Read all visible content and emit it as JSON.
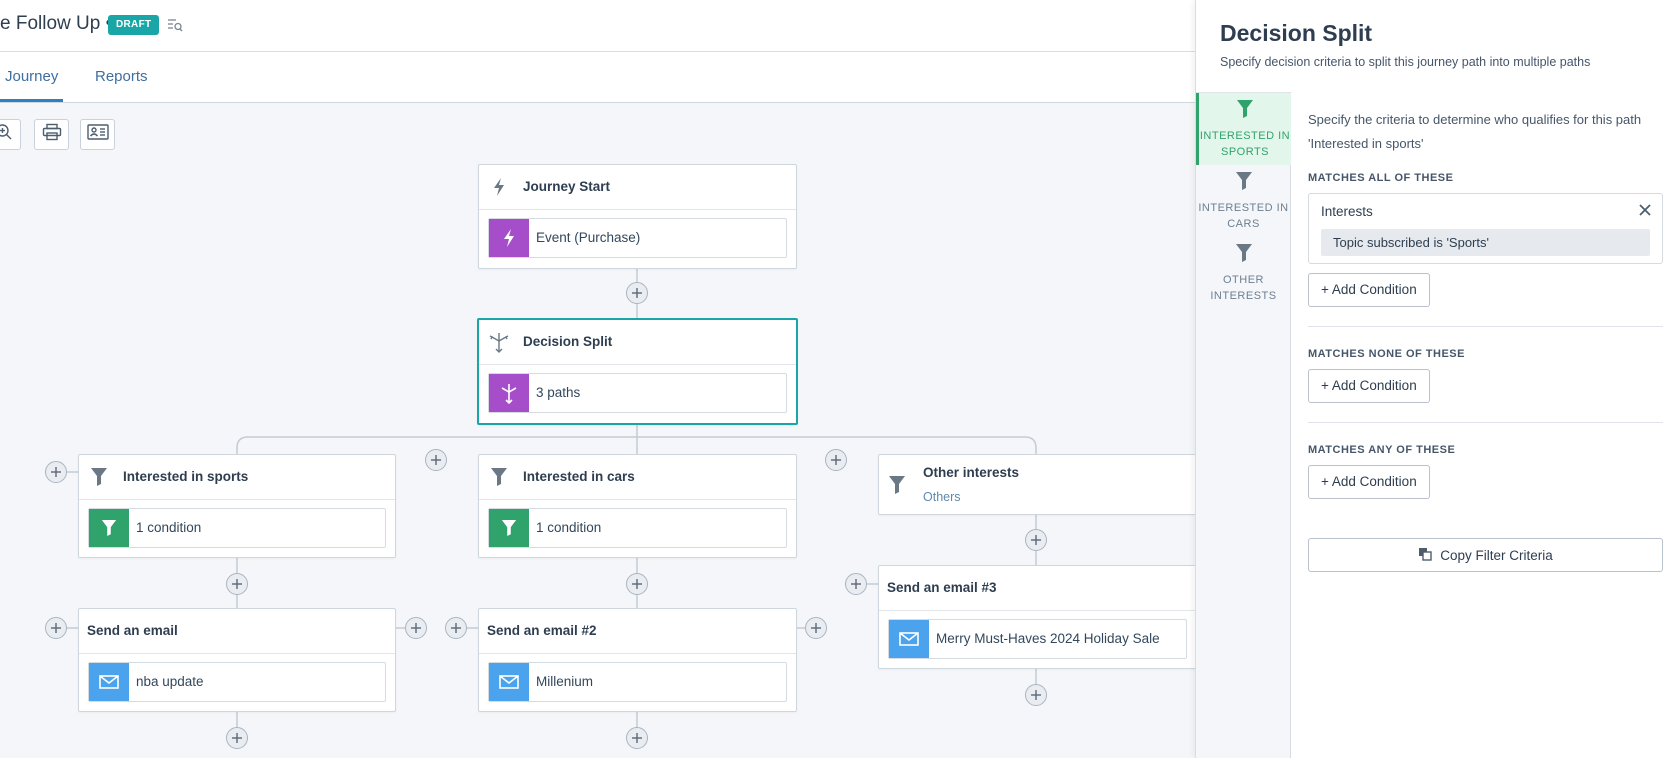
{
  "header": {
    "title": "e Follow Up •",
    "status_badge": "DRAFT"
  },
  "tabs": [
    {
      "label": "Journey",
      "active": true
    },
    {
      "label": "Reports",
      "active": false
    }
  ],
  "toolbar": {
    "buttons": [
      "zoom-in-icon",
      "print-icon",
      "contact-card-icon"
    ]
  },
  "nodes": {
    "journey_start": {
      "title": "Journey Start",
      "body": "Event (Purchase)"
    },
    "decision_split": {
      "title": "Decision Split",
      "body": "3 paths"
    },
    "sports": {
      "title": "Interested in sports",
      "body": "1 condition"
    },
    "cars": {
      "title": "Interested in cars",
      "body": "1 condition"
    },
    "other": {
      "title": "Other interests",
      "subtitle": "Others"
    },
    "email1": {
      "title": "Send an email",
      "body": "nba update"
    },
    "email2": {
      "title": "Send an email #2",
      "body": "Millenium"
    },
    "email3": {
      "title": "Send an email #3",
      "body": "Merry Must-Haves 2024 Holiday Sale"
    }
  },
  "panel": {
    "title": "Decision Split",
    "subtitle": "Specify decision criteria to split this journey path into multiple paths",
    "nav": [
      {
        "label": "INTERESTED IN SPORTS",
        "active": true
      },
      {
        "label": "INTERESTED IN CARS",
        "active": false
      },
      {
        "label": "OTHER INTERESTS",
        "active": false
      }
    ],
    "description": "Specify the criteria to determine who qualifies for this path 'Interested in sports'",
    "matches_all": {
      "heading": "MATCHES ALL OF THESE",
      "criteria_title": "Interests",
      "criteria_value": "Topic subscribed is 'Sports'",
      "add_label": "+ Add Condition"
    },
    "matches_none": {
      "heading": "MATCHES NONE OF THESE",
      "add_label": "+ Add Condition"
    },
    "matches_any": {
      "heading": "MATCHES ANY OF THESE",
      "add_label": "+ Add Condition"
    },
    "copy_label": "Copy Filter Criteria"
  },
  "colors": {
    "accent_teal": "#1aa6a6",
    "event_purple": "#a64ec9",
    "filter_green": "#2fa36b",
    "email_blue": "#4aa3ec"
  }
}
